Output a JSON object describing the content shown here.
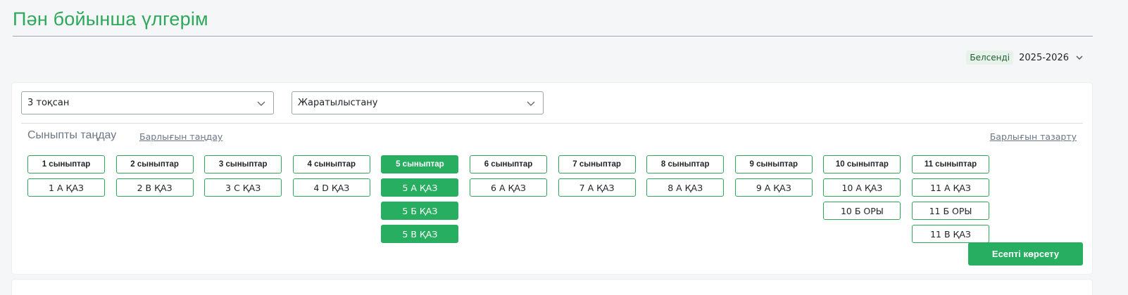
{
  "page": {
    "title": "Пән бойынша үлгерім"
  },
  "year_selector": {
    "status": "Белсенді",
    "year": "2025-2026"
  },
  "filters": {
    "quarter": {
      "value": "3 тоқсан"
    },
    "subject": {
      "value": "Жаратылыстану"
    }
  },
  "class_selection": {
    "heading": "Сыныпты таңдау",
    "select_all_label": "Барлығын таңдау",
    "clear_all_label": "Барлығын тазарту",
    "groups": [
      {
        "grade": "1 сыныптар",
        "active": false,
        "classes": [
          {
            "label": "1 А ҚАЗ",
            "active": false
          }
        ]
      },
      {
        "grade": "2 сыныптар",
        "active": false,
        "classes": [
          {
            "label": "2 В ҚАЗ",
            "active": false
          }
        ]
      },
      {
        "grade": "3 сыныптар",
        "active": false,
        "classes": [
          {
            "label": "3 С ҚАЗ",
            "active": false
          }
        ]
      },
      {
        "grade": "4 сыныптар",
        "active": false,
        "classes": [
          {
            "label": "4 D ҚАЗ",
            "active": false
          }
        ]
      },
      {
        "grade": "5 сыныптар",
        "active": true,
        "classes": [
          {
            "label": "5 А ҚАЗ",
            "active": true
          },
          {
            "label": "5 Б ҚАЗ",
            "active": true
          },
          {
            "label": "5 В ҚАЗ",
            "active": true
          }
        ]
      },
      {
        "grade": "6 сыныптар",
        "active": false,
        "classes": [
          {
            "label": "6 А ҚАЗ",
            "active": false
          }
        ]
      },
      {
        "grade": "7 сыныптар",
        "active": false,
        "classes": [
          {
            "label": "7 А ҚАЗ",
            "active": false
          }
        ]
      },
      {
        "grade": "8 сыныптар",
        "active": false,
        "classes": [
          {
            "label": "8 А ҚАЗ",
            "active": false
          }
        ]
      },
      {
        "grade": "9 сыныптар",
        "active": false,
        "classes": [
          {
            "label": "9 А ҚАЗ",
            "active": false
          }
        ]
      },
      {
        "grade": "10 сыныптар",
        "active": false,
        "classes": [
          {
            "label": "10 А ҚАЗ",
            "active": false
          },
          {
            "label": "10 Б ОРЫ",
            "active": false
          }
        ]
      },
      {
        "grade": "11 сыныптар",
        "active": false,
        "classes": [
          {
            "label": "11 А ҚАЗ",
            "active": false
          },
          {
            "label": "11 Б ОРЫ",
            "active": false
          },
          {
            "label": "11 В ҚАЗ",
            "active": false
          }
        ]
      }
    ]
  },
  "actions": {
    "show_report_label": "Есепті көрсету"
  },
  "colors": {
    "accent": "#27ae60",
    "title": "#2ea85a",
    "muted": "#6b7785"
  },
  "icons": {
    "dropdown": "chevron-down-icon"
  }
}
